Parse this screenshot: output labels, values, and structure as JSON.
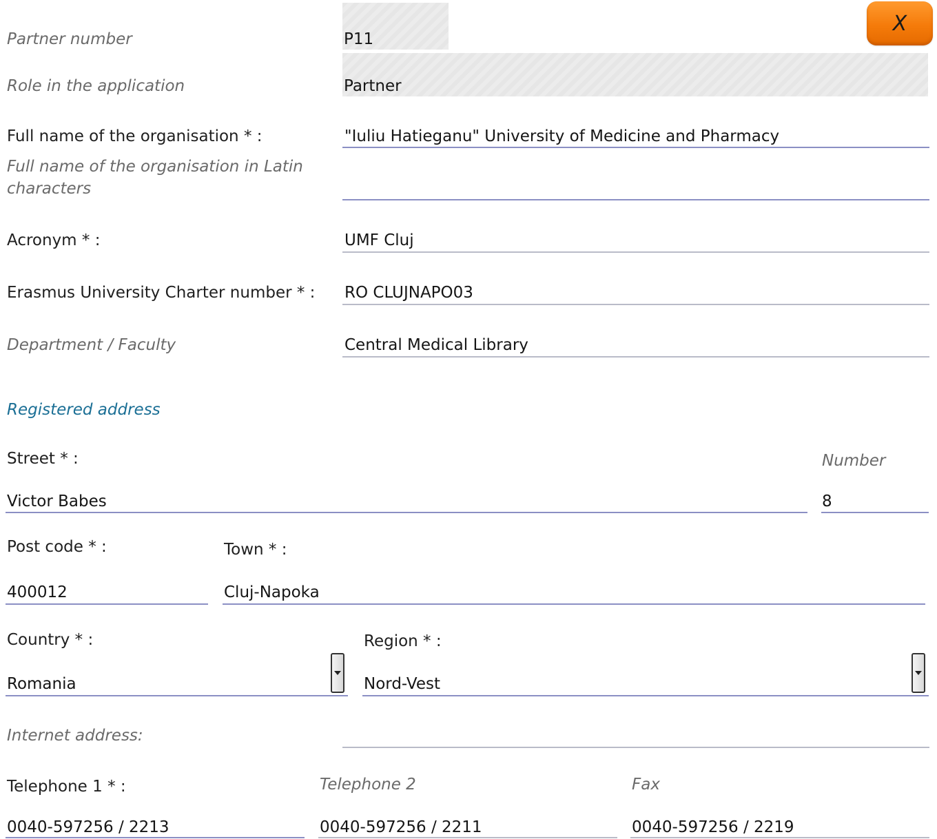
{
  "close_button": {
    "label": "X"
  },
  "partner_number": {
    "label": "Partner number",
    "value": "P11"
  },
  "role": {
    "label": "Role in the application",
    "value": "Partner"
  },
  "full_name": {
    "label": "Full name of the organisation * :",
    "value": "\"Iuliu Hatieganu\" University of Medicine and Pharmacy"
  },
  "full_name_latin": {
    "label_line1": "Full name of the organisation in Latin",
    "label_line2": "characters",
    "value": ""
  },
  "acronym": {
    "label": "Acronym * :",
    "value": "UMF Cluj"
  },
  "erasmus_charter": {
    "label": "Erasmus University Charter number * :",
    "value": "RO CLUJNAPO03"
  },
  "department": {
    "label": "Department / Faculty",
    "value": "Central Medical Library"
  },
  "registered_address": {
    "title": "Registered address",
    "street": {
      "label": "Street * :",
      "value": "Victor Babes"
    },
    "number": {
      "label": "Number",
      "value": "8"
    },
    "post_code": {
      "label": "Post code * :",
      "value": "400012"
    },
    "town": {
      "label": "Town * :",
      "value": "Cluj-Napoka"
    },
    "country": {
      "label": "Country * :",
      "value": "Romania"
    },
    "region": {
      "label": "Region * :",
      "value": "Nord-Vest"
    }
  },
  "internet_address": {
    "label": "Internet address:",
    "value": ""
  },
  "telephone1": {
    "label": "Telephone 1 * :",
    "value": "0040-597256 / 2213"
  },
  "telephone2": {
    "label": "Telephone 2",
    "value": "0040-597256 / 2211"
  },
  "fax": {
    "label": "Fax",
    "value": "0040-597256 / 2219"
  },
  "icons": {
    "close": "close-icon",
    "dropdown": "chevron-down-icon"
  }
}
